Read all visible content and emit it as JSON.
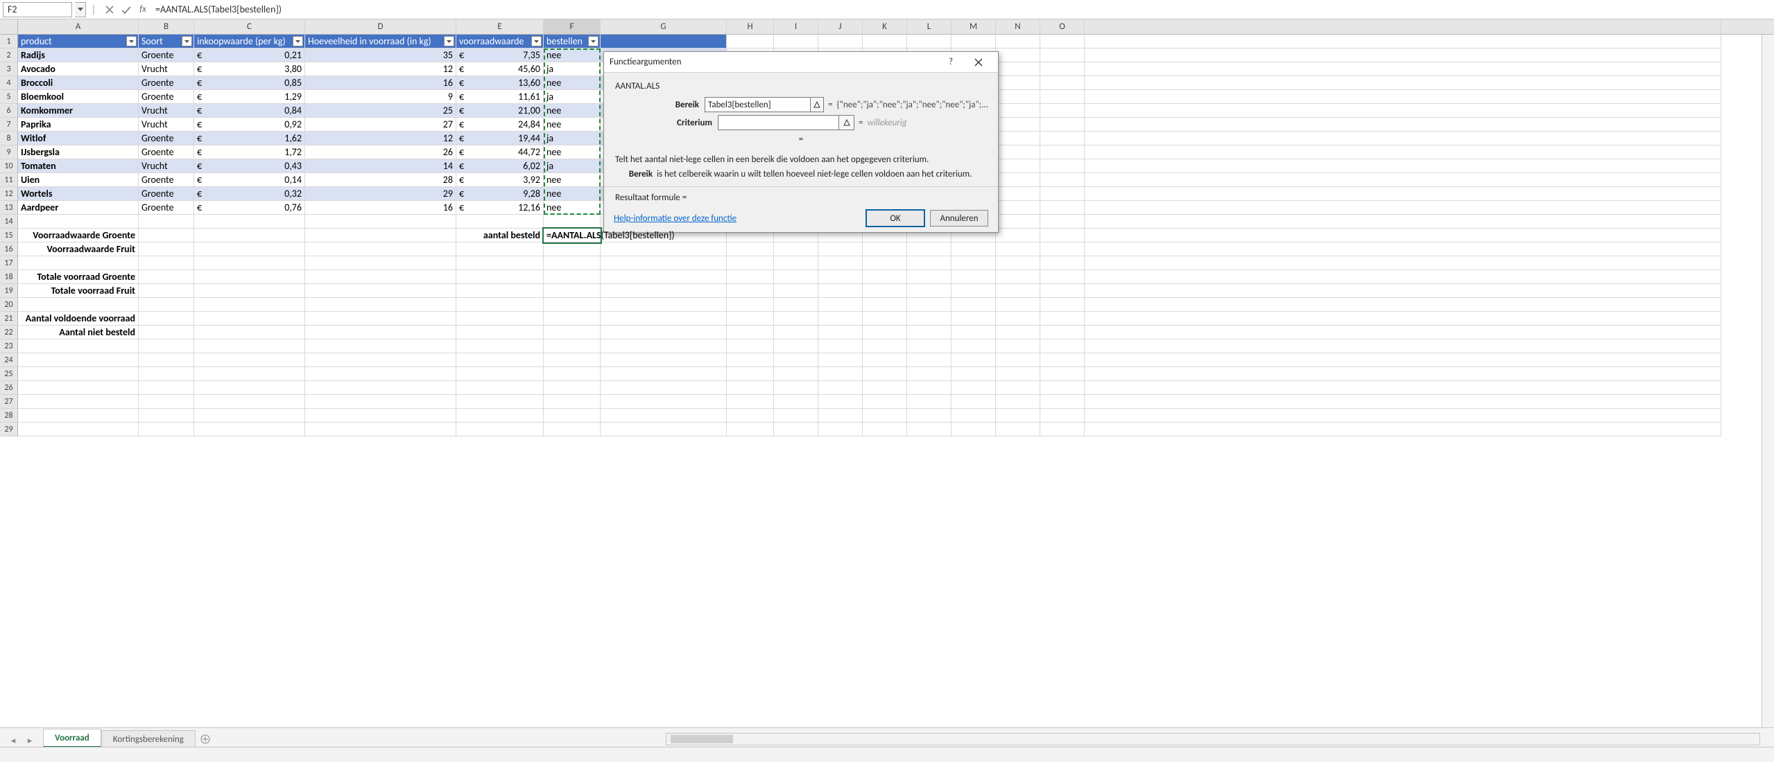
{
  "formula_bar": {
    "name_box": "F2",
    "formula": "=AANTAL.ALS(Tabel3[bestellen])"
  },
  "columns": [
    "A",
    "B",
    "C",
    "D",
    "E",
    "F",
    "G",
    "H",
    "I",
    "J",
    "K",
    "L",
    "M",
    "N",
    "O"
  ],
  "table": {
    "headers": {
      "A": "product",
      "B": "Soort",
      "C": "inkoopwaarde (per kg)",
      "D": "Hoeveelheid in voorraad (in kg)",
      "E": "voorraadwaarde",
      "F": "bestellen"
    },
    "rows": [
      {
        "product": "Radijs",
        "soort": "Groente",
        "inkoop": "0,21",
        "hoev": "35",
        "voorraad": "7,35",
        "bestellen": "nee"
      },
      {
        "product": "Avocado",
        "soort": "Vrucht",
        "inkoop": "3,80",
        "hoev": "12",
        "voorraad": "45,60",
        "bestellen": "ja"
      },
      {
        "product": "Broccoli",
        "soort": "Groente",
        "inkoop": "0,85",
        "hoev": "16",
        "voorraad": "13,60",
        "bestellen": "nee"
      },
      {
        "product": "Bloemkool",
        "soort": "Groente",
        "inkoop": "1,29",
        "hoev": "9",
        "voorraad": "11,61",
        "bestellen": "ja"
      },
      {
        "product": "Komkommer",
        "soort": "Vrucht",
        "inkoop": "0,84",
        "hoev": "25",
        "voorraad": "21,00",
        "bestellen": "nee"
      },
      {
        "product": "Paprika",
        "soort": "Vrucht",
        "inkoop": "0,92",
        "hoev": "27",
        "voorraad": "24,84",
        "bestellen": "nee"
      },
      {
        "product": "Witlof",
        "soort": "Groente",
        "inkoop": "1,62",
        "hoev": "12",
        "voorraad": "19,44",
        "bestellen": "ja"
      },
      {
        "product": "IJsbergsla",
        "soort": "Groente",
        "inkoop": "1,72",
        "hoev": "26",
        "voorraad": "44,72",
        "bestellen": "nee"
      },
      {
        "product": "Tomaten",
        "soort": "Vrucht",
        "inkoop": "0,43",
        "hoev": "14",
        "voorraad": "6,02",
        "bestellen": "ja"
      },
      {
        "product": "Uien",
        "soort": "Groente",
        "inkoop": "0,14",
        "hoev": "28",
        "voorraad": "3,92",
        "bestellen": "nee"
      },
      {
        "product": "Wortels",
        "soort": "Groente",
        "inkoop": "0,32",
        "hoev": "29",
        "voorraad": "9,28",
        "bestellen": "nee"
      },
      {
        "product": "Aardpeer",
        "soort": "Groente",
        "inkoop": "0,76",
        "hoev": "16",
        "voorraad": "12,16",
        "bestellen": "nee"
      }
    ]
  },
  "labels": {
    "r15A": "Voorraadwaarde Groente",
    "r15E": "aantal besteld",
    "r15F_fn": "=AANTAL.ALS",
    "r15F_rest": "(Tabel3[bestellen])",
    "r16A": "Voorraadwaarde Fruit",
    "r18A": "Totale voorraad Groente",
    "r19A": "Totale voorraad Fruit",
    "r21A": "Aantal voldoende voorraad",
    "r22A": "Aantal niet besteld"
  },
  "dialog": {
    "title": "Functieargumenten",
    "fn": "AANTAL.ALS",
    "arg1_label": "Bereik",
    "arg1_value": "Tabel3[bestellen]",
    "arg1_preview": "{\"nee\";\"ja\";\"nee\";\"ja\";\"nee\";\"nee\";\"ja\";...",
    "arg2_label": "Criterium",
    "arg2_value": "",
    "arg2_preview": "willekeurig",
    "center_eq": "=",
    "desc": "Telt het aantal niet-lege cellen in een bereik die voldoen aan het opgegeven criterium.",
    "argdesc_name": "Bereik",
    "argdesc_text": "is het celbereik waarin u wilt tellen hoeveel niet-lege cellen voldoen aan het criterium.",
    "result_label": "Resultaat formule =",
    "help": "Help-informatie over deze functie",
    "ok": "OK",
    "cancel": "Annuleren"
  },
  "tabs": {
    "active": "Voorraad",
    "other": "Kortingsberekening"
  },
  "misc": {
    "euro": "€"
  }
}
